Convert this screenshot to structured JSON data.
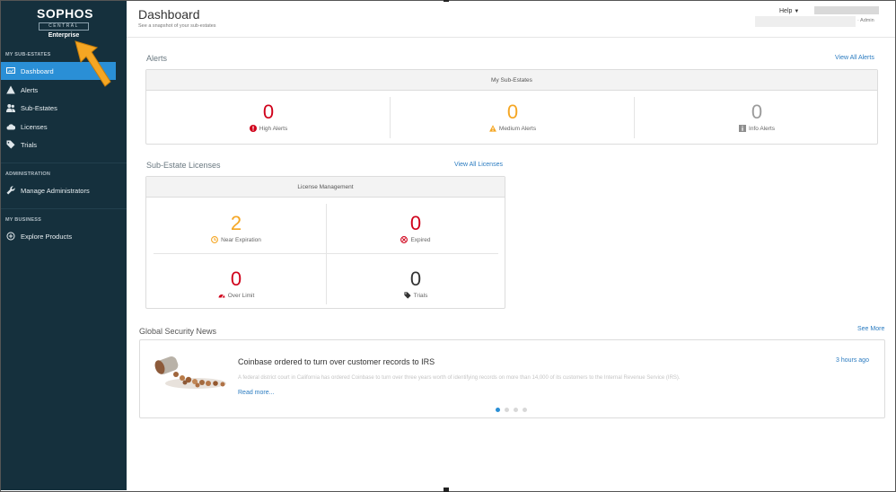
{
  "sidebar": {
    "brand": "SOPHOS",
    "central": "CENTRAL",
    "edition": "Enterprise",
    "sections": [
      {
        "title": "MY SUB-ESTATES"
      },
      {
        "title": "ADMINISTRATION"
      },
      {
        "title": "MY BUSINESS"
      }
    ],
    "items": [
      {
        "label": "Dashboard",
        "icon": "dashboard-icon",
        "active": true
      },
      {
        "label": "Alerts",
        "icon": "warning-icon"
      },
      {
        "label": "Sub-Estates",
        "icon": "users-icon"
      },
      {
        "label": "Licenses",
        "icon": "cloud-icon"
      },
      {
        "label": "Trials",
        "icon": "tag-icon"
      },
      {
        "label": "Manage Administrators",
        "icon": "wrench-icon"
      },
      {
        "label": "Explore Products",
        "icon": "plus-circle-icon"
      }
    ]
  },
  "header": {
    "title": "Dashboard",
    "subtitle": "See a snapshot of your sub-estates",
    "help": "Help",
    "role": "· Admin"
  },
  "alerts": {
    "heading": "Alerts",
    "view_all": "View All Alerts",
    "panel_title": "My Sub-Estates",
    "metrics": [
      {
        "value": "0",
        "label": "High Alerts",
        "color": "#d0021b"
      },
      {
        "value": "0",
        "label": "Medium Alerts",
        "color": "#f5a623"
      },
      {
        "value": "0",
        "label": "Info Alerts",
        "color": "#9b9b9b"
      }
    ]
  },
  "licenses": {
    "heading": "Sub-Estate Licenses",
    "view_all": "View All Licenses",
    "panel_title": "License Management",
    "metrics": [
      {
        "value": "2",
        "label": "Near Expiration",
        "color": "#f5a623"
      },
      {
        "value": "0",
        "label": "Expired",
        "color": "#d0021b"
      },
      {
        "value": "0",
        "label": "Over Limit",
        "color": "#d0021b"
      },
      {
        "value": "0",
        "label": "Trials",
        "color": "#333333"
      }
    ]
  },
  "news": {
    "heading": "Global Security News",
    "see_more": "See More",
    "title": "Coinbase ordered to turn over customer records to IRS",
    "time": "3 hours ago",
    "snippet": "A federal district court in California has ordered Coinbase to turn over three years worth of identifying records on more than 14,000 of its customers to the Internal Revenue Service (IRS).",
    "read_more": "Read more..."
  },
  "colors": {
    "sidebar": "#15303d",
    "accent": "#2a8fd6",
    "link": "#2a7bc0"
  }
}
